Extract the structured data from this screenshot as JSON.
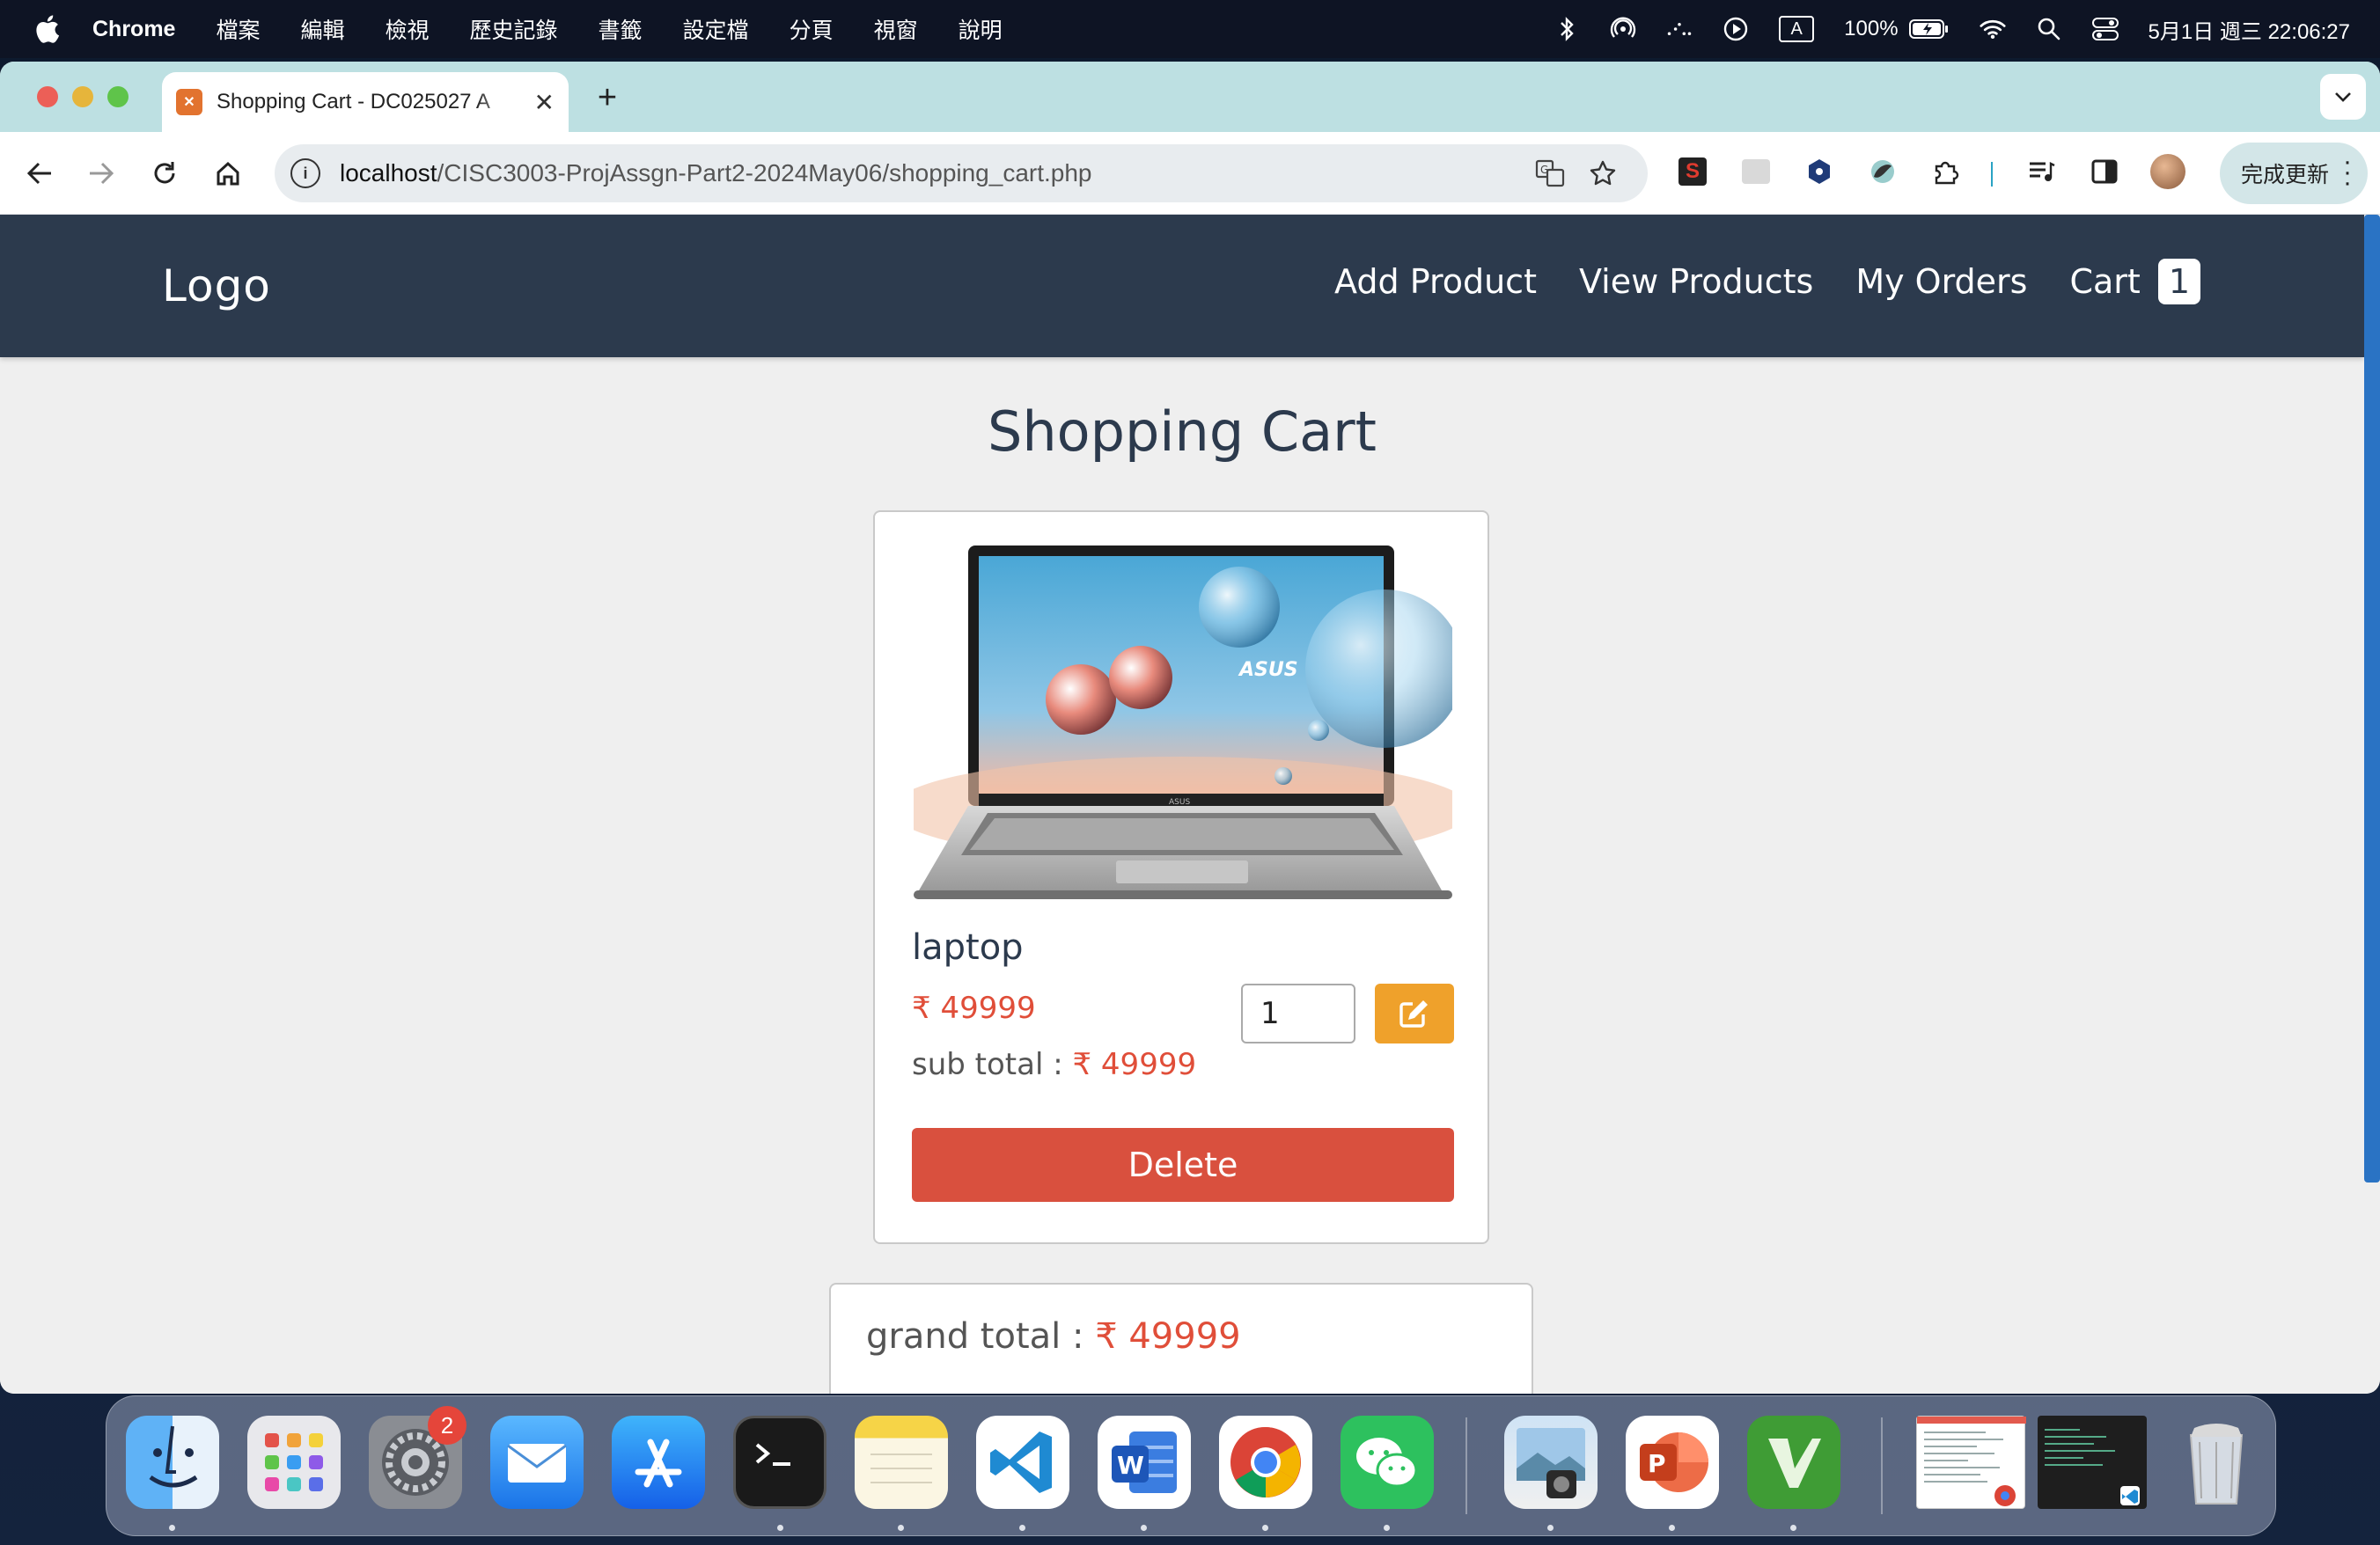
{
  "menubar": {
    "app_name": "Chrome",
    "menus": [
      "檔案",
      "編輯",
      "檢視",
      "歷史記錄",
      "書籤",
      "設定檔",
      "分頁",
      "視窗",
      "說明"
    ],
    "input_indicator": "A",
    "battery": "100%",
    "datetime": "5月1日 週三 22:06:27"
  },
  "browser": {
    "tab_title": "Shopping Cart - DC025027 A",
    "url_host": "localhost",
    "url_path": "/CISC3003-ProjAssgn-Part2-2024May06/shopping_cart.php",
    "update_button": "完成更新"
  },
  "site": {
    "logo": "Logo",
    "nav": [
      "Add Product",
      "View Products",
      "My Orders"
    ],
    "cart_label": "Cart",
    "cart_count": "1"
  },
  "page": {
    "title": "Shopping Cart"
  },
  "cart_item": {
    "name": "laptop",
    "price": "₹ 49999",
    "subtotal_label": "sub total :",
    "subtotal_value": "₹ 49999",
    "quantity": "1",
    "delete_label": "Delete"
  },
  "summary": {
    "grand_total_label": "grand total :",
    "grand_total_value": "₹ 49999"
  },
  "dock": {
    "apps": [
      "Finder",
      "Launchpad",
      "System Settings",
      "Mail",
      "App Store",
      "Terminal",
      "Notes",
      "Visual Studio Code",
      "Microsoft Word",
      "Google Chrome",
      "WeChat",
      "Preview",
      "Microsoft PowerPoint",
      "Vim",
      "Chrome Window",
      "Code Window",
      "Trash"
    ],
    "settings_badge": "2"
  }
}
